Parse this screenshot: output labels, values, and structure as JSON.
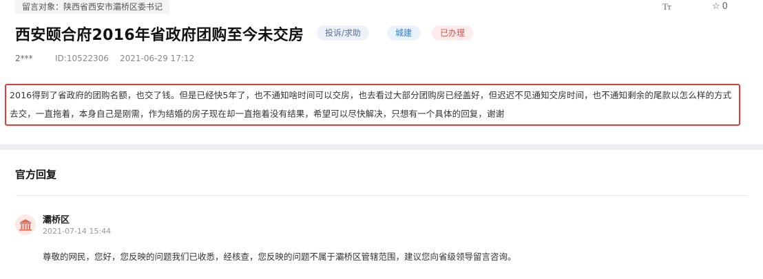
{
  "message": {
    "target_label": "留言对象：陕西省西安市灞桥区委书记",
    "font_size_icon_text": "Tт",
    "favorite_count": "0",
    "title": "西安颐合府2016年省政府团购至今未交房",
    "tags": {
      "type": "投诉/求助",
      "field": "城建",
      "status": "已办理"
    },
    "author": "2***",
    "id_text": "ID:10522306",
    "time": "2021-06-29 17:12",
    "content": "2016得到了省政府的团购名额，也交了钱。但是已经快5年了，也不通知啥时间可以交房，也去看过大部分团购房已经盖好，但迟迟不见通知交房时间，也不通知剩余的尾款以怎么样的方式去交，一直拖着，本身自己是刚需，作为结婚的房子现在却一直拖着没有结果，希望可以尽快解决，只想有一个具体的回复，谢谢"
  },
  "reply": {
    "heading": "官方回复",
    "department": "灞桥区",
    "time": "2021-07-14 15:44",
    "text": "尊敬的网民，您好，您反映的问题我们已收悉，经核查，您反映的问题不属于灞桥区管辖范围，建议您向省级领导留言咨询。"
  },
  "colors": {
    "highlight_border": "#e23b3b",
    "status_tag": "#d9534f",
    "field_tag": "#3a7cc9"
  },
  "icons": [
    "font-size-icon",
    "star-icon",
    "government-building-icon"
  ]
}
